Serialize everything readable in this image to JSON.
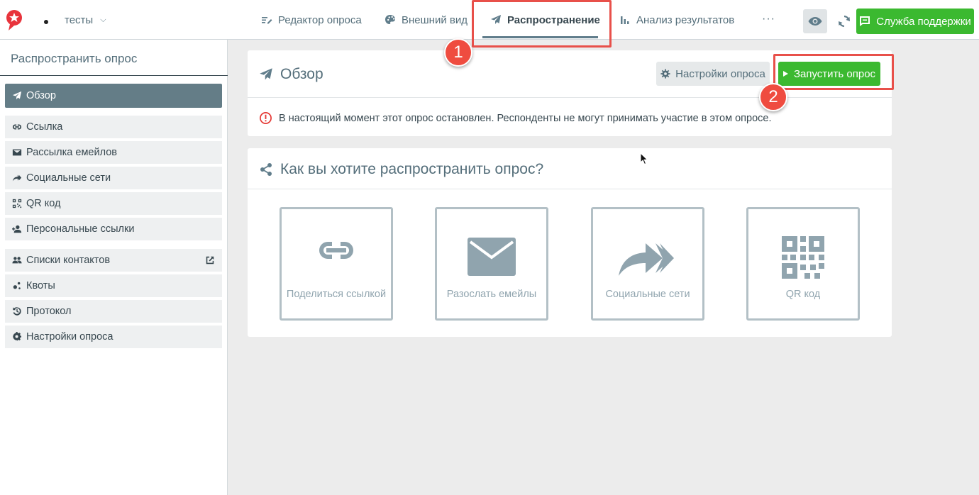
{
  "header": {
    "project_name": "тесты",
    "tabs": [
      {
        "label": "Редактор опроса",
        "icon": "pencil-lines-icon"
      },
      {
        "label": "Внешний вид",
        "icon": "palette-icon"
      },
      {
        "label": "Распространение",
        "icon": "paper-plane-icon",
        "active": true
      },
      {
        "label": "Анализ результатов",
        "icon": "bar-chart-icon"
      }
    ],
    "more_label": "···",
    "support_label": "Служба поддержки"
  },
  "sidebar": {
    "title": "Распространить опрос",
    "items": [
      {
        "label": "Обзор",
        "icon": "paper-plane-icon",
        "active": true
      },
      {
        "label": "Ссылка",
        "icon": "link-icon"
      },
      {
        "label": "Рассылка емейлов",
        "icon": "envelope-icon"
      },
      {
        "label": "Социальные сети",
        "icon": "share-arrow-icon"
      },
      {
        "label": "QR код",
        "icon": "qr-code-icon"
      },
      {
        "label": "Персональные ссылки",
        "icon": "user-plus-icon"
      },
      {
        "label": "Списки контактов",
        "icon": "users-icon"
      },
      {
        "label": "Квоты",
        "icon": "quota-icon"
      },
      {
        "label": "Протокол",
        "icon": "history-icon"
      },
      {
        "label": "Настройки опроса",
        "icon": "gear-icon"
      }
    ]
  },
  "overview": {
    "title": "Обзор",
    "settings_label": "Настройки опроса",
    "launch_label": "Запустить опрос",
    "notice": "В настоящий момент этот опрос остановлен. Респонденты не могут принимать участие в этом опросе."
  },
  "distribute": {
    "title": "Как вы хотите распространить опрос?",
    "options": [
      {
        "label": "Поделиться ссылкой",
        "icon": "link-icon"
      },
      {
        "label": "Разослать емейлы",
        "icon": "envelope-icon"
      },
      {
        "label": "Социальные сети",
        "icon": "share-arrow-icon"
      },
      {
        "label": "QR код",
        "icon": "qr-code-icon"
      }
    ]
  },
  "annotations": {
    "step1": "1",
    "step2": "2",
    "highlight_color": "#e8504a"
  },
  "colors": {
    "accent_green": "#3bb930",
    "active_sidebar": "#647d87",
    "tile_border": "#b3c0c6"
  }
}
